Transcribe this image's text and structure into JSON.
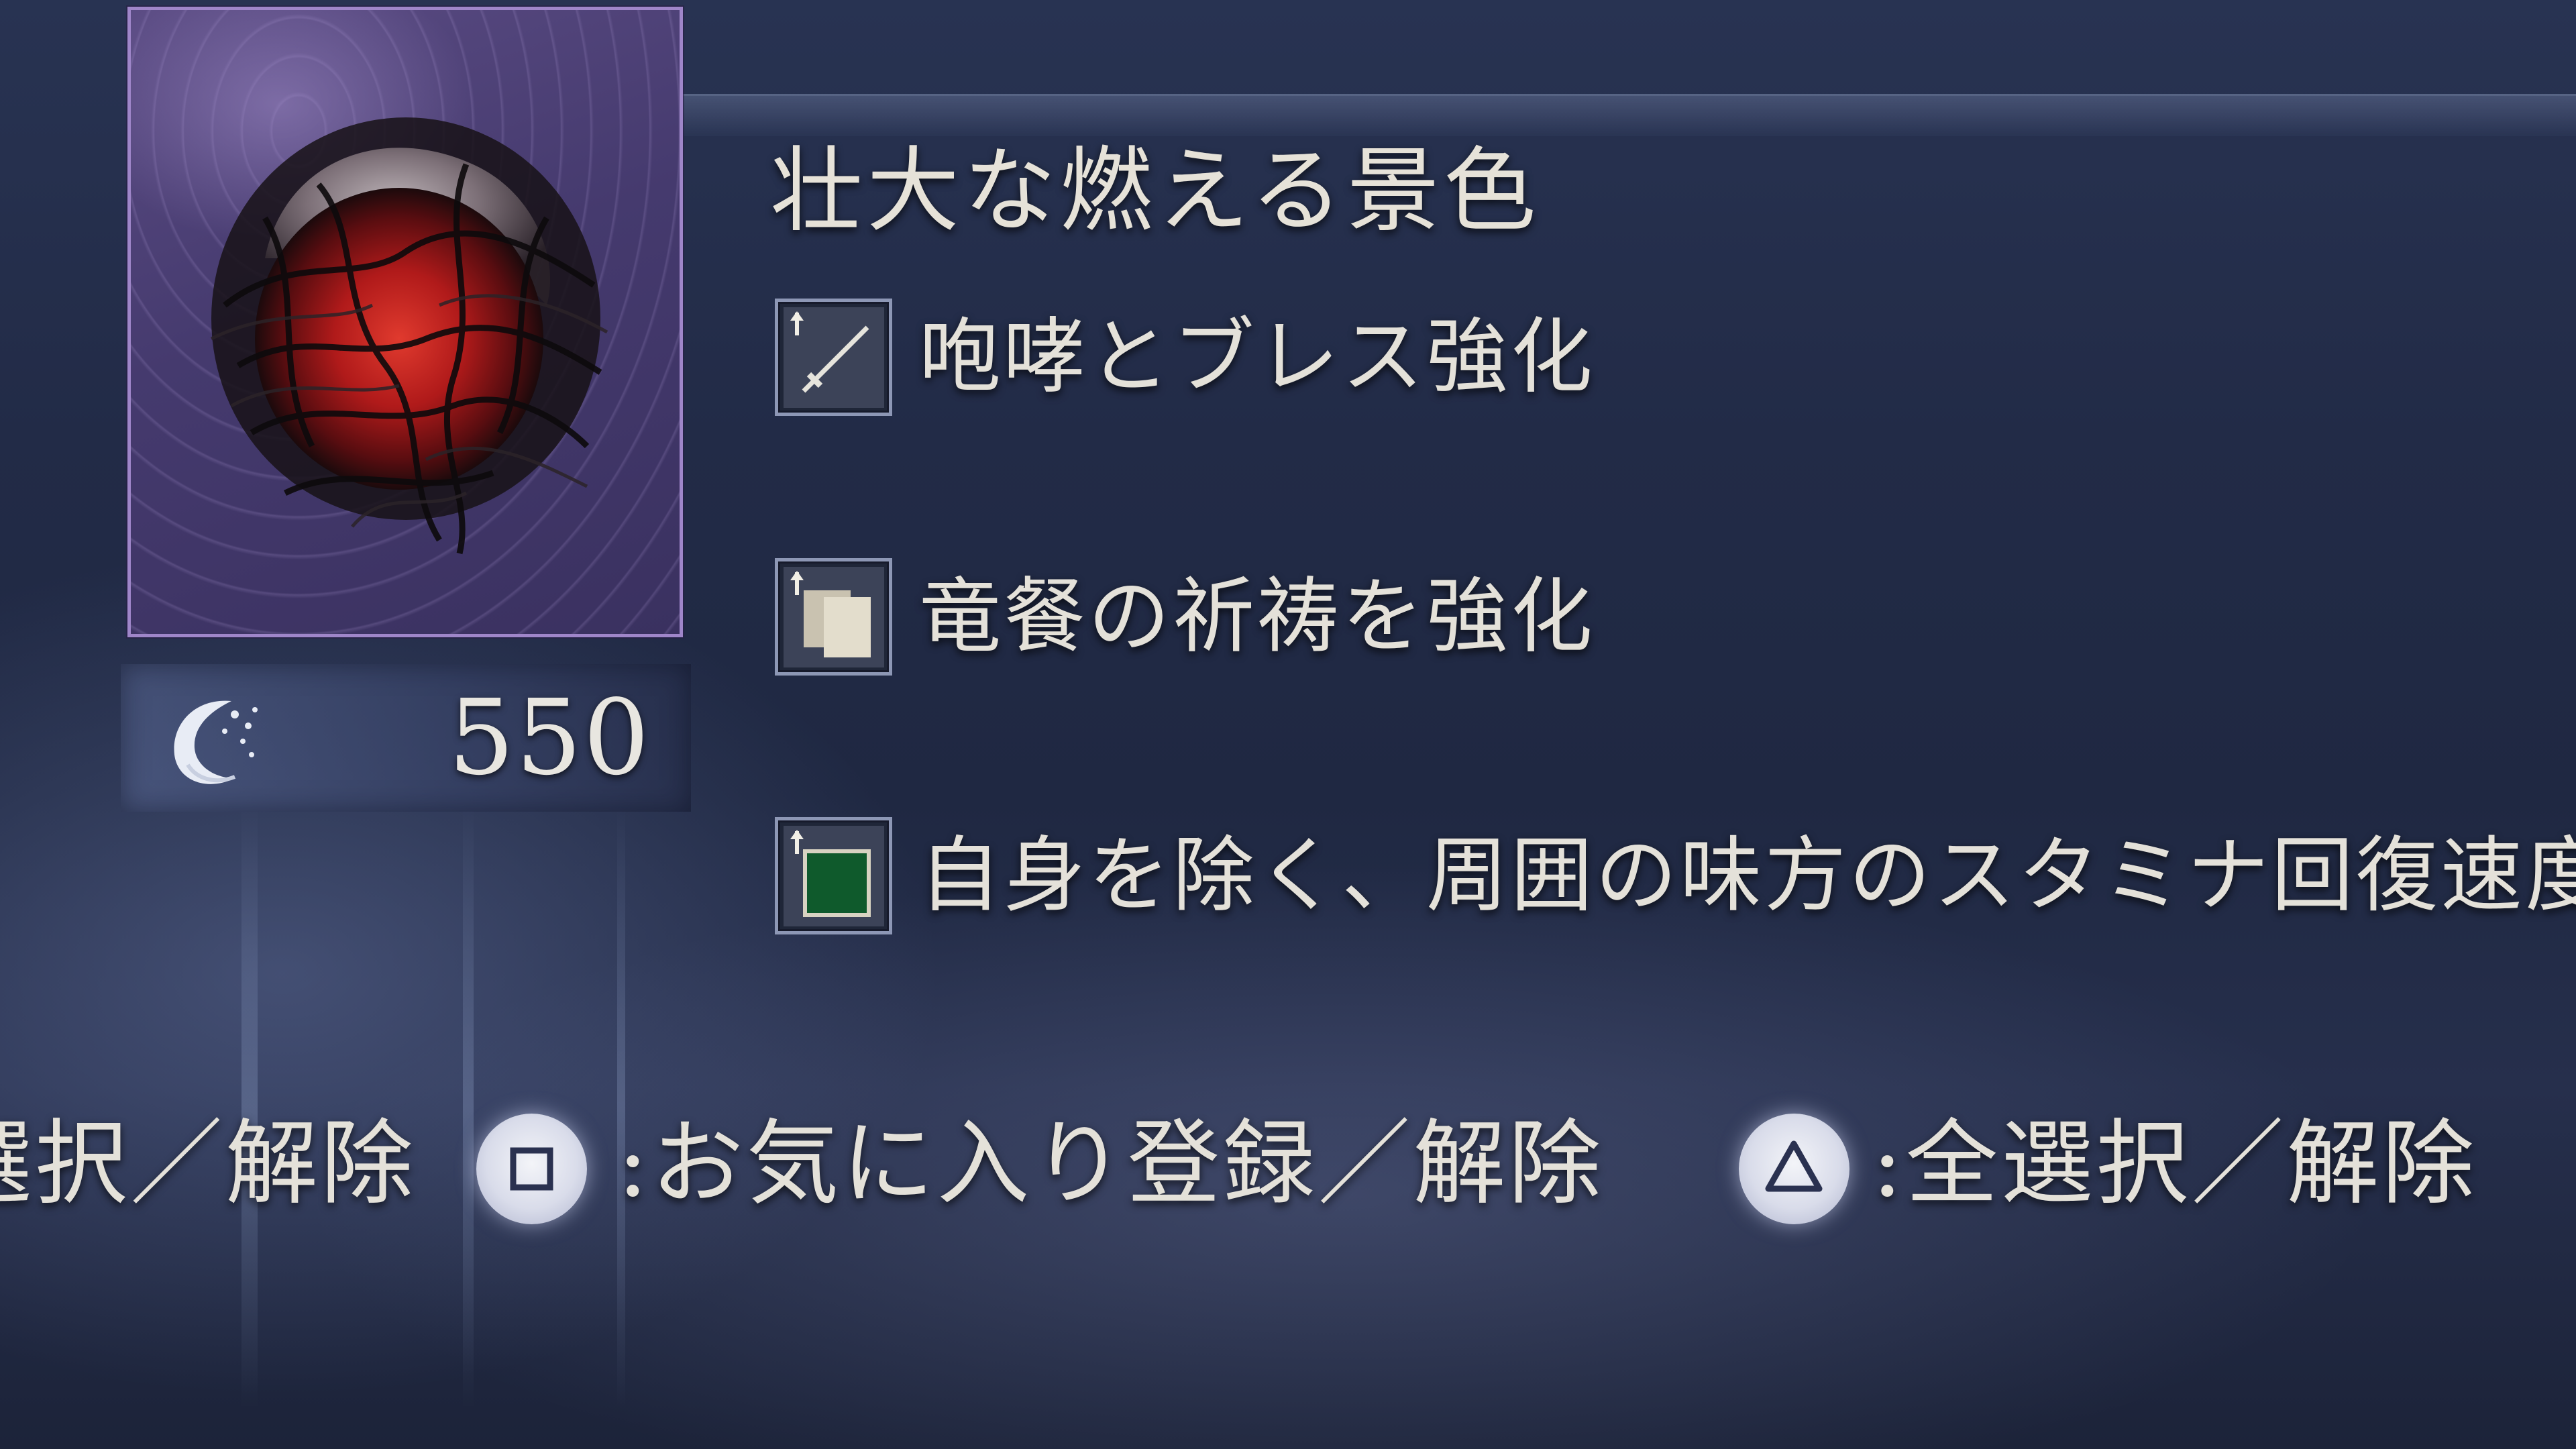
{
  "relic": {
    "name": "壮大な燃える景色",
    "image_icon": "burning-scene-relic-icon",
    "cost": "550",
    "cost_icon": "rune-currency-icon"
  },
  "effects": [
    {
      "label": "咆哮とブレス強化",
      "icon": "sword-upgrade-icon"
    },
    {
      "label": "竜餐の祈祷を強化",
      "icon": "scroll-upgrade-icon"
    },
    {
      "label": "自身を除く、周囲の味方のスタミナ回復速度",
      "icon": "green-tile-upgrade-icon"
    }
  ],
  "button_hints": {
    "select": "選択／解除",
    "favorite_button": "□",
    "favorite": ":お気に入り登録／解除",
    "select_all_button": "△",
    "select_all": ":全選択／解除"
  },
  "colors": {
    "background": "#222b47",
    "frame_border": "#9f86c9",
    "text": "#e4e1d9",
    "relic_core": "#b01a1a"
  }
}
